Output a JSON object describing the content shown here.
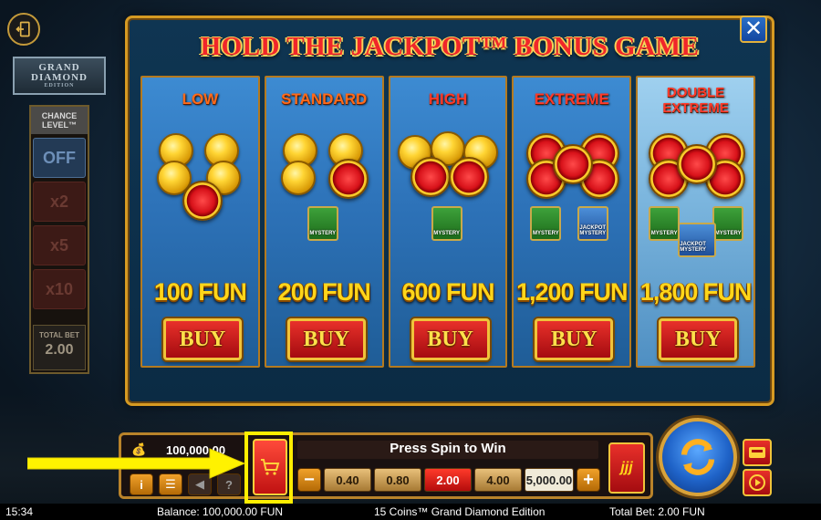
{
  "modal": {
    "title": "HOLD THE JACKPOT™ BONUS GAME",
    "close_label": "✕"
  },
  "sidebar": {
    "logo_top": "GRAND",
    "logo_main": "DIAMOND",
    "logo_sub": "EDITION",
    "chance_label": "CHANCE LEVEL™",
    "chance_options": [
      "OFF",
      "x2",
      "x5",
      "x10"
    ],
    "chance_selected": "OFF",
    "total_bet_label": "TOTAL BET",
    "total_bet_value": "2.00"
  },
  "cards": [
    {
      "name": "LOW",
      "price": "100 FUN",
      "buy": "BUY",
      "mystery": []
    },
    {
      "name": "STANDARD",
      "price": "200 FUN",
      "buy": "BUY",
      "mystery": [
        "MYSTERY"
      ]
    },
    {
      "name": "HIGH",
      "price": "600 FUN",
      "buy": "BUY",
      "mystery": [
        "MYSTERY"
      ]
    },
    {
      "name": "EXTREME",
      "price": "1,200 FUN",
      "buy": "BUY",
      "mystery": [
        "MYSTERY",
        "JACKPOT MYSTERY"
      ]
    },
    {
      "name_line1": "DOUBLE",
      "name_line2": "EXTREME",
      "price": "1,800 FUN",
      "buy": "BUY",
      "mystery": [
        "MYSTERY",
        "MYSTERY",
        "JACKPOT MYSTERY"
      ]
    }
  ],
  "controls": {
    "balance_display": "100,000.00",
    "spin_message": "Press Spin to Win",
    "bet_minus": "−",
    "bet_plus": "+",
    "bet_options": [
      "0.40",
      "0.80",
      "2.00",
      "4.00",
      "5,000.00"
    ],
    "bet_selected": "2.00",
    "info_icon": "i",
    "menu_icon": "☰",
    "help_icon": "?",
    "turbo_label": "jjj"
  },
  "status": {
    "time": "15:34",
    "balance": "Balance: 100,000.00 FUN",
    "game_name": "15 Coins™ Grand Diamond Edition",
    "total_bet": "Total Bet: 2.00 FUN"
  },
  "icons": [
    "exit-icon",
    "coin-bag-icon",
    "cart-icon",
    "sound-icon",
    "spin-icon",
    "autoplay-icon",
    "play-icon"
  ],
  "colors": {
    "accent_gold": "#d69a22",
    "highlight_yellow": "#ffee00",
    "title_red": "#f0262a",
    "price_yellow": "#ffd61a"
  }
}
